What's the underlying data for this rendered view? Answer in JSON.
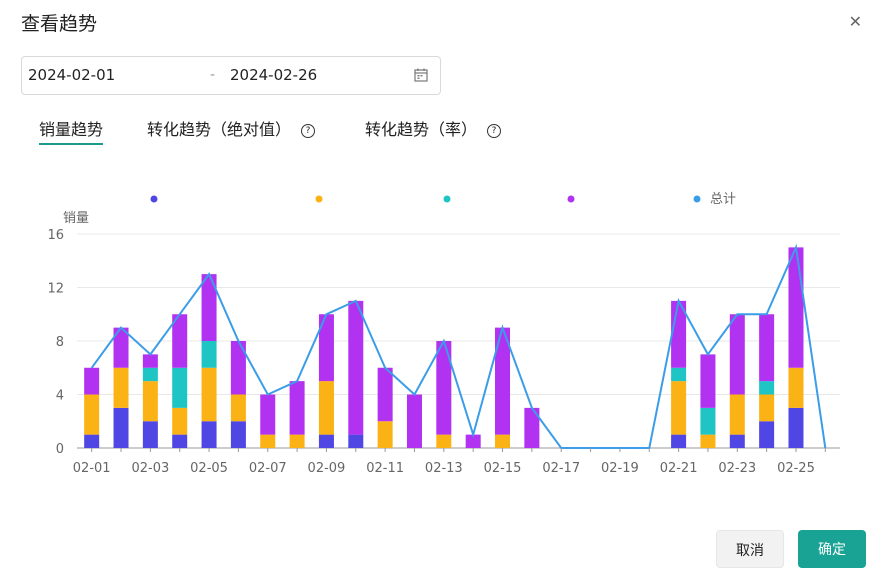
{
  "dialog": {
    "title": "查看趋势",
    "close_icon": "close-icon"
  },
  "date_range": {
    "start": "2024-02-01",
    "separator": "-",
    "end": "2024-02-26",
    "icon": "calendar-icon"
  },
  "tabs": [
    {
      "label": "销量趋势",
      "active": true,
      "help": false
    },
    {
      "label": "转化趋势（绝对值）",
      "active": false,
      "help": true
    },
    {
      "label": "转化趋势（率）",
      "active": false,
      "help": true
    }
  ],
  "buttons": {
    "cancel": "取消",
    "confirm": "确定"
  },
  "colors": {
    "accent": "#18a394",
    "series1": "#5046e4",
    "series2": "#fbb215",
    "series3": "#1fc4c4",
    "series4": "#b132f0",
    "total": "#3b9de8"
  },
  "chart_data": {
    "type": "bar",
    "ylabel": "销量",
    "ylim": [
      0,
      16
    ],
    "yticks": [
      0,
      4,
      8,
      12,
      16
    ],
    "categories": [
      "02-01",
      "02-02",
      "02-03",
      "02-04",
      "02-05",
      "02-06",
      "02-07",
      "02-08",
      "02-09",
      "02-10",
      "02-11",
      "02-12",
      "02-13",
      "02-14",
      "02-15",
      "02-16",
      "02-17",
      "02-18",
      "02-19",
      "02-20",
      "02-21",
      "02-22",
      "02-23",
      "02-24",
      "02-25",
      "02-26"
    ],
    "xtick_labels": [
      "02-01",
      "02-03",
      "02-05",
      "02-07",
      "02-09",
      "02-11",
      "02-13",
      "02-15",
      "02-17",
      "02-19",
      "02-21",
      "02-23",
      "02-25"
    ],
    "legend_position": "top",
    "series": [
      {
        "color": "#5046e4",
        "values": [
          1,
          3,
          2,
          1,
          2,
          2,
          0,
          0,
          1,
          1,
          0,
          0,
          0,
          0,
          0,
          0,
          0,
          0,
          0,
          0,
          1,
          0,
          1,
          2,
          3,
          0
        ]
      },
      {
        "color": "#fbb215",
        "values": [
          3,
          3,
          3,
          2,
          4,
          2,
          1,
          1,
          4,
          0,
          2,
          0,
          1,
          0,
          1,
          0,
          0,
          0,
          0,
          0,
          4,
          1,
          3,
          2,
          3,
          0
        ]
      },
      {
        "color": "#1fc4c4",
        "values": [
          0,
          0,
          1,
          3,
          2,
          0,
          0,
          0,
          0,
          0,
          0,
          0,
          0,
          0,
          0,
          0,
          0,
          0,
          0,
          0,
          1,
          2,
          0,
          1,
          0,
          0
        ]
      },
      {
        "color": "#b132f0",
        "values": [
          2,
          3,
          1,
          4,
          5,
          4,
          3,
          4,
          5,
          10,
          4,
          4,
          7,
          1,
          8,
          3,
          0,
          0,
          0,
          0,
          5,
          4,
          6,
          5,
          9,
          0
        ]
      },
      {
        "name": "总计",
        "type": "line",
        "color": "#3b9de8",
        "values": [
          6,
          9,
          7,
          10,
          13,
          8,
          4,
          5,
          10,
          11,
          6,
          4,
          8,
          1,
          9,
          3,
          0,
          0,
          0,
          0,
          11,
          7,
          10,
          10,
          15,
          0
        ]
      }
    ]
  }
}
